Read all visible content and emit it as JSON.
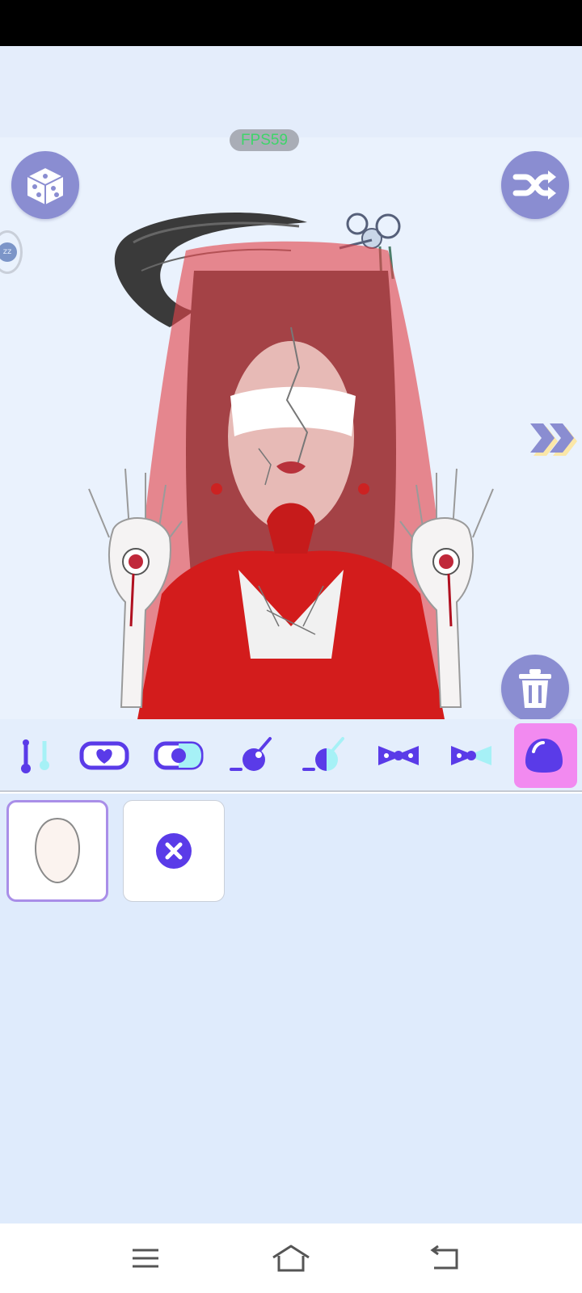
{
  "hud": {
    "fps_text": "FPS59"
  },
  "buttons": {
    "dice_icon": "dice-icon",
    "shuffle_icon": "shuffle-icon",
    "trash_icon": "trash-icon",
    "next_icon": "double-chevron-right-icon",
    "sleep_badge": "zz"
  },
  "toolbar": {
    "tools": [
      {
        "name": "eyelash-pair-tool",
        "icon": "lash-icon"
      },
      {
        "name": "heart-blush-tool",
        "icon": "heart-rect-icon"
      },
      {
        "name": "split-blush-tool",
        "icon": "split-rect-icon"
      },
      {
        "name": "eye-shine-tool",
        "icon": "drop-icon"
      },
      {
        "name": "eye-shine-alt-tool",
        "icon": "drop-split-icon"
      },
      {
        "name": "bow-tool",
        "icon": "bow-icon"
      },
      {
        "name": "bow-alt-tool",
        "icon": "bow-split-icon"
      },
      {
        "name": "face-shape-tool",
        "icon": "blob-icon",
        "active": true
      }
    ]
  },
  "options": [
    {
      "name": "face-base-option",
      "icon": "face-outline-icon",
      "selected": true
    },
    {
      "name": "none-option",
      "icon": "close-circle-icon",
      "selected": false
    }
  ],
  "colors": {
    "accent": "#5a3be8",
    "button_bg": "#8a8dd1",
    "active_tool_bg": "#f28af0",
    "fps_text": "#3fd46a",
    "selected_border": "#a98ee8"
  },
  "nav": {
    "menu_icon": "menu-icon",
    "home_icon": "home-icon",
    "back_icon": "back-icon"
  }
}
